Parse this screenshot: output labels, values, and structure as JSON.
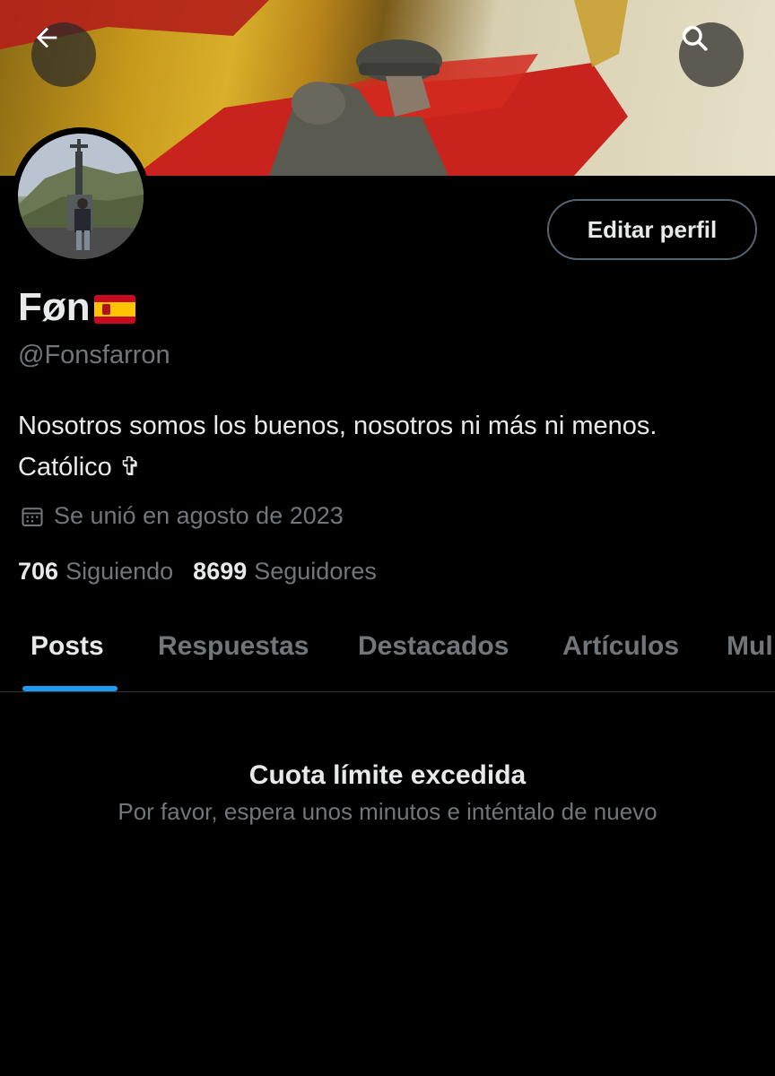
{
  "profile": {
    "display_name": "Føn",
    "handle": "@Fonsfarron",
    "bio_line1": "Nosotros somos los buenos, nosotros ni más ni menos.",
    "bio_line2": "Católico ✞",
    "joined": "Se unió en agosto de 2023",
    "following_count": "706",
    "following_label": "Siguiendo",
    "followers_count": "8699",
    "followers_label": "Seguidores"
  },
  "header": {
    "edit_button_label": "Editar perfil",
    "back_icon": "arrow-left-icon",
    "search_icon": "search-icon"
  },
  "tabs": [
    {
      "label": "Posts",
      "active": true
    },
    {
      "label": "Respuestas",
      "active": false
    },
    {
      "label": "Destacados",
      "active": false
    },
    {
      "label": "Artículos",
      "active": false
    },
    {
      "label": "Mul",
      "active": false
    }
  ],
  "empty_state": {
    "title": "Cuota límite excedida",
    "subtitle": "Por favor, espera unos minutos e inténtalo de nuevo"
  },
  "colors": {
    "background": "#000000",
    "primary_text": "#e7e9ea",
    "secondary_text": "#71767b",
    "accent": "#1d9bf0",
    "border": "#2f3336"
  }
}
